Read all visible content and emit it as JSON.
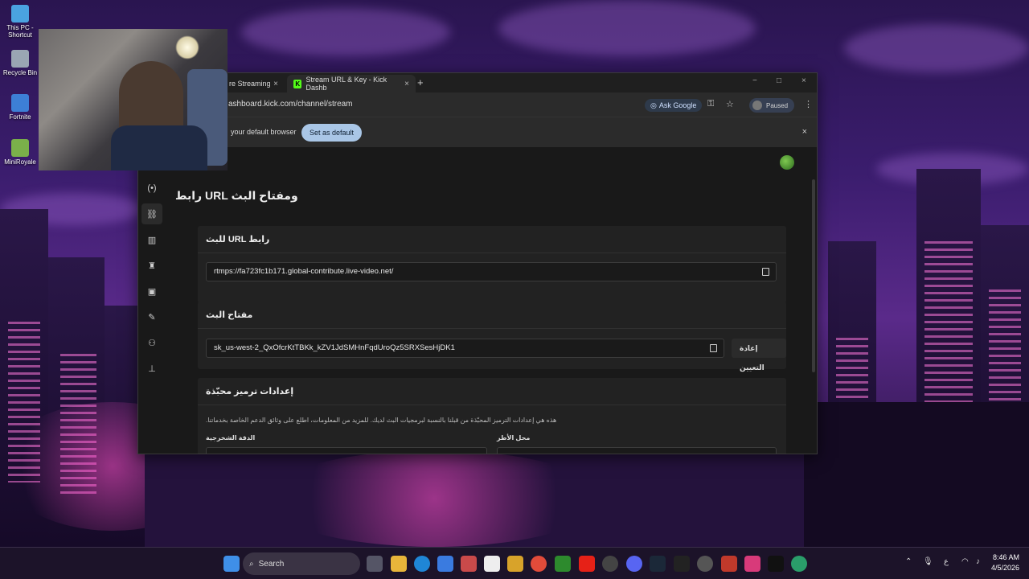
{
  "desktop": {
    "icons": [
      {
        "label": "This PC - Shortcut"
      },
      {
        "label": "Recycle Bin"
      },
      {
        "label": "Fortnite"
      },
      {
        "label": "MiniRoyale"
      }
    ]
  },
  "browser": {
    "tabs": [
      {
        "label": "re Streaming"
      },
      {
        "label": "Stream URL & Key - Kick Dashb"
      }
    ],
    "new_tab": "+",
    "window_controls": {
      "minimize": "−",
      "maximize": "□",
      "close": "×"
    },
    "address": "ashboard.kick.com/channel/stream",
    "ask_google": "Ask Google",
    "paused": "Paused",
    "infobar": {
      "message": "your default browser",
      "button": "Set as default",
      "close": "×"
    }
  },
  "page": {
    "title": "ومفتاح البث URL رابط",
    "url_card": {
      "title": "للبث URL رابط",
      "value": "rtmps://fa723fc1b171.global-contribute.live-video.net/"
    },
    "key_card": {
      "title": "مفتاح البث",
      "value": "sk_us-west-2_QxOfcrKtTBKk_kZV1JdSMHnFqdUroQz5SRXSesHjDK1",
      "reset": "إعادة التعيين"
    },
    "encoding_card": {
      "title": "إعدادات ترميز محبّذة",
      "description": "هذه هي إعدادات الترميز المحبّذة من قبلنا بالنسبة لبرمجيات البث لديك. للمزيد من المعلومات، اطلع على وثائق الدعم الخاصة بخدماتنا.",
      "resolution_label": "الدقة الشخرجية",
      "framerate_label": "محل الأطر"
    }
  },
  "taskbar": {
    "search": "Search",
    "lang": "ع",
    "time": "8:46 AM",
    "date": "4/5/2026"
  },
  "colors": {
    "kick_green": "#53fc18",
    "page_bg": "#191919",
    "card_bg": "#222222"
  }
}
